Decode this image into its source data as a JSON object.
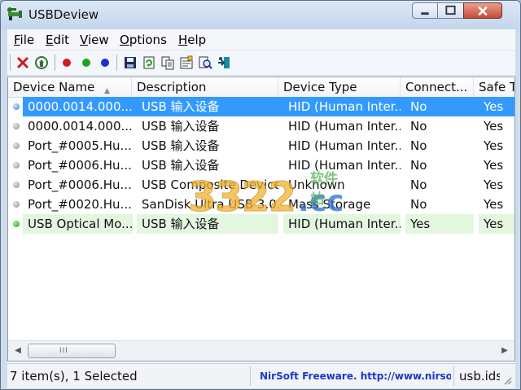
{
  "window": {
    "title": "USBDeview",
    "controls": [
      "minimize-icon",
      "maximize-icon",
      "close-icon"
    ]
  },
  "menu": [
    {
      "accel": "F",
      "rest": "ile"
    },
    {
      "accel": "E",
      "rest": "dit"
    },
    {
      "accel": "V",
      "rest": "iew"
    },
    {
      "accel": "O",
      "rest": "ptions"
    },
    {
      "accel": "H",
      "rest": "elp"
    }
  ],
  "toolbar": {
    "icons": [
      "uninstall-x-icon",
      "recycle-icon",
      "red-dot-icon",
      "green-dot-icon",
      "blue-dot-icon",
      "save-icon",
      "refresh-icon",
      "copy-icon",
      "properties-icon",
      "find-icon",
      "exit-icon"
    ],
    "colors": {
      "red": "#d21c1c",
      "green": "#1ea31e",
      "blue": "#1e2fd1"
    }
  },
  "table": {
    "columns": [
      "Device Name",
      "Description",
      "Device Type",
      "Connect...",
      "Safe T"
    ],
    "sort_indicator": "▲",
    "rows": [
      {
        "name": "0000.0014.000...",
        "desc": "USB 输入设备",
        "type": "HID (Human Inter...",
        "connected": "No",
        "safe": "Yes",
        "selected": true,
        "connected_flag": false
      },
      {
        "name": "0000.0014.000...",
        "desc": "USB 输入设备",
        "type": "HID (Human Inter...",
        "connected": "No",
        "safe": "Yes",
        "selected": false,
        "connected_flag": false
      },
      {
        "name": "Port_#0005.Hu...",
        "desc": "USB 输入设备",
        "type": "HID (Human Inter...",
        "connected": "No",
        "safe": "Yes",
        "selected": false,
        "connected_flag": false
      },
      {
        "name": "Port_#0006.Hu...",
        "desc": "USB 输入设备",
        "type": "HID (Human Inter...",
        "connected": "No",
        "safe": "Yes",
        "selected": false,
        "connected_flag": false
      },
      {
        "name": "Port_#0006.Hu...",
        "desc": "USB Composite Device",
        "type": "Unknown",
        "connected": "No",
        "safe": "Yes",
        "selected": false,
        "connected_flag": false
      },
      {
        "name": "Port_#0020.Hu...",
        "desc": "SanDisk Ultra USB 3.0...",
        "type": "Mass Storage",
        "connected": "No",
        "safe": "Yes",
        "selected": false,
        "connected_flag": false
      },
      {
        "name": "USB Optical Mo...",
        "desc": "USB 输入设备",
        "type": "HID (Human Inter...",
        "connected": "Yes",
        "safe": "Yes",
        "selected": false,
        "connected_flag": true
      }
    ],
    "scroll_grip": "III"
  },
  "status": {
    "count": "7 item(s), 1 Selected",
    "nirsoft": "NirSoft Freeware.  http://www.nirsoft.net",
    "ids": "usb.ids"
  },
  "watermark": {
    "main": "3322",
    "suffix": ".cc",
    "cn": "软件站"
  }
}
